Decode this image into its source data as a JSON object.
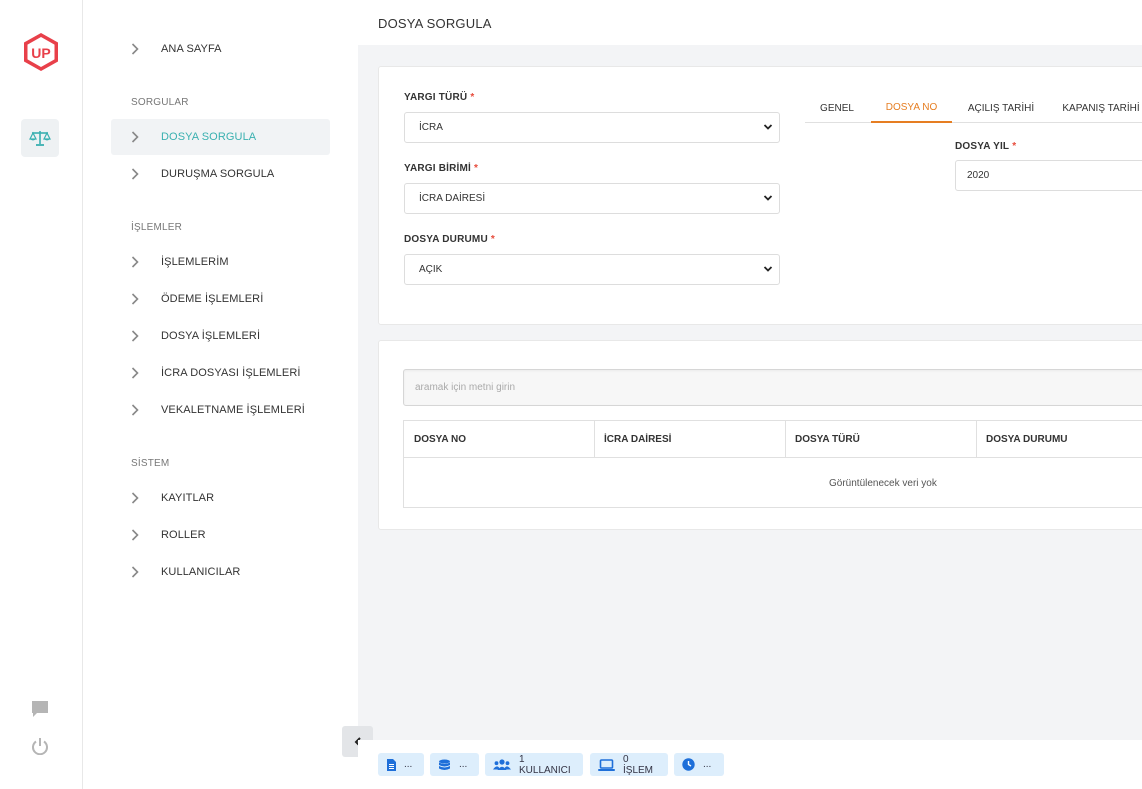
{
  "brand": {
    "logo_text": "UP"
  },
  "colors": {
    "accent": "#3ab0b0",
    "tab_active": "#e67e22",
    "required": "#e74c3c",
    "pill_bg": "#ddeefc",
    "pill_icon": "#1e6fd9"
  },
  "menu": {
    "home": "ANA SAYFA",
    "sections": [
      {
        "title": "SORGULAR",
        "items": [
          "DOSYA SORGULA",
          "DURUŞMA SORGULA"
        ]
      },
      {
        "title": "İŞLEMLER",
        "items": [
          "İŞLEMLERİM",
          "ÖDEME İŞLEMLERİ",
          "DOSYA İŞLEMLERİ",
          "İCRA DOSYASI İŞLEMLERİ",
          "VEKALETNAME İŞLEMLERİ"
        ]
      },
      {
        "title": "SİSTEM",
        "items": [
          "KAYITLAR",
          "ROLLER",
          "KULLANICILAR"
        ]
      }
    ],
    "active": "DOSYA SORGULA"
  },
  "header": {
    "title": "DOSYA SORGULA"
  },
  "form": {
    "yargi_turu": {
      "label": "YARGI TÜRÜ",
      "value": "İCRA"
    },
    "yargi_birimi": {
      "label": "YARGI BİRİMİ",
      "value": "İCRA DAİRESİ"
    },
    "dosya_durumu": {
      "label": "DOSYA DURUMU",
      "value": "AÇIK"
    },
    "required_mark": "*",
    "tabs": [
      "GENEL",
      "DOSYA NO",
      "AÇILIŞ TARİHİ",
      "KAPANIŞ TARİHİ"
    ],
    "active_tab": "DOSYA NO",
    "dosya_yil": {
      "label": "DOSYA YIL",
      "value": "2020"
    }
  },
  "table": {
    "search_placeholder": "aramak için metni girin",
    "columns": [
      "DOSYA NO",
      "İCRA DAİRESİ",
      "DOSYA TÜRÜ",
      "DOSYA DURUMU"
    ],
    "empty_text": "Görüntülenecek veri yok"
  },
  "statusbar": {
    "pills": [
      {
        "icon": "document-icon",
        "label": "..."
      },
      {
        "icon": "database-icon",
        "label": "..."
      },
      {
        "icon": "users-icon",
        "label": "1 KULLANICI"
      },
      {
        "icon": "laptop-icon",
        "label": "0 İŞLEM"
      },
      {
        "icon": "clock-icon",
        "label": "..."
      }
    ]
  }
}
